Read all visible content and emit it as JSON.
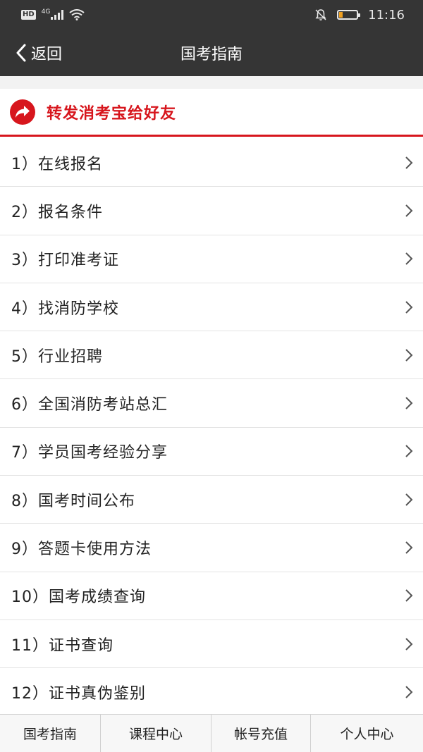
{
  "status_bar": {
    "hd": "HD",
    "network": "4G",
    "time": "11:16",
    "icons": [
      "signal-icon",
      "wifi-icon",
      "mute-icon",
      "battery-icon"
    ],
    "battery_level": 0.22
  },
  "navbar": {
    "back_label": "返回",
    "title": "国考指南"
  },
  "share": {
    "label": "转发消考宝给好友",
    "icon": "share-arrow-icon"
  },
  "menu": {
    "items": [
      {
        "label": "1）在线报名"
      },
      {
        "label": "2）报名条件"
      },
      {
        "label": "3）打印准考证"
      },
      {
        "label": "4）找消防学校"
      },
      {
        "label": "5）行业招聘"
      },
      {
        "label": "6）全国消防考站总汇"
      },
      {
        "label": "7）学员国考经验分享"
      },
      {
        "label": "8）国考时间公布"
      },
      {
        "label": "9）答题卡使用方法"
      },
      {
        "label": "10）国考成绩查询"
      },
      {
        "label": "11）证书查询"
      },
      {
        "label": "12）证书真伪鉴别"
      }
    ]
  },
  "tabbar": {
    "tabs": [
      {
        "label": "国考指南"
      },
      {
        "label": "课程中心"
      },
      {
        "label": "帐号充值"
      },
      {
        "label": "个人中心"
      }
    ]
  },
  "colors": {
    "accent": "#d7161d",
    "header": "#353535",
    "battery": "#f0a020"
  }
}
